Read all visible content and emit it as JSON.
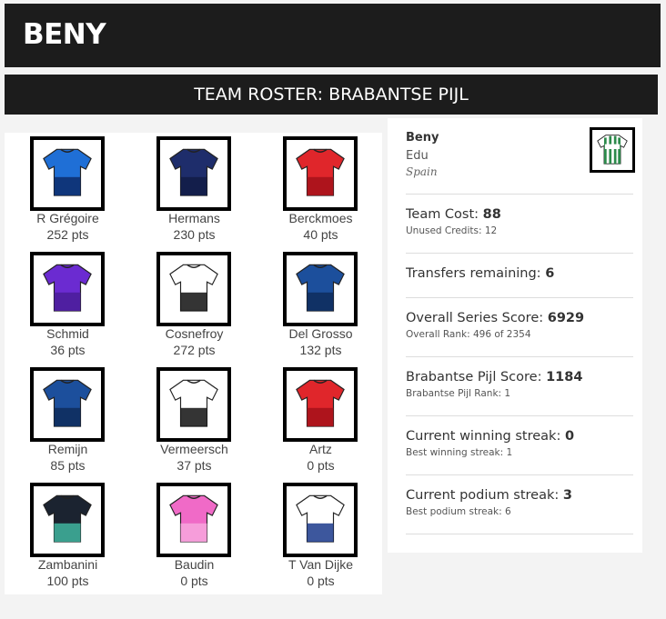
{
  "header": {
    "brand": "BENY"
  },
  "roster_title": "TEAM ROSTER: BRABANTSE PIJL",
  "riders": [
    {
      "name": "R Grégoire",
      "points": "252 pts",
      "jersey_icon": "groupama-fdj-jersey-icon",
      "colors": [
        "#1f6fd6",
        "#0d2d6b"
      ]
    },
    {
      "name": "Hermans",
      "points": "230 pts",
      "jersey_icon": "israel-premier-tech-jersey-icon",
      "colors": [
        "#1e2d6b",
        "#121c45"
      ]
    },
    {
      "name": "Berckmoes",
      "points": "40 pts",
      "jersey_icon": "lotto-jersey-icon",
      "colors": [
        "#e0262b",
        "#a5121a"
      ]
    },
    {
      "name": "Schmid",
      "points": "36 pts",
      "jersey_icon": "jayco-alula-jersey-icon",
      "colors": [
        "#6b2bd1",
        "#4a1d99"
      ]
    },
    {
      "name": "Cosnefroy",
      "points": "272 pts",
      "jersey_icon": "uae-team-emirates-jersey-icon",
      "colors": [
        "#ffffff",
        "#111111"
      ]
    },
    {
      "name": "Del Grosso",
      "points": "132 pts",
      "jersey_icon": "alpecin-jersey-icon",
      "colors": [
        "#1c4f9c",
        "#0e2b5c"
      ]
    },
    {
      "name": "Remijn",
      "points": "85 pts",
      "jersey_icon": "alpecin-jersey-icon",
      "colors": [
        "#1c4f9c",
        "#0e2b5c"
      ]
    },
    {
      "name": "Vermeersch",
      "points": "37 pts",
      "jersey_icon": "uae-team-emirates-jersey-icon",
      "colors": [
        "#ffffff",
        "#111111"
      ]
    },
    {
      "name": "Artz",
      "points": "0 pts",
      "jersey_icon": "lotto-jersey-icon",
      "colors": [
        "#e0262b",
        "#a5121a"
      ]
    },
    {
      "name": "Zambanini",
      "points": "100 pts",
      "jersey_icon": "bahrain-victorious-jersey-icon",
      "colors": [
        "#1b2330",
        "#3fb59f"
      ]
    },
    {
      "name": "Baudin",
      "points": "0 pts",
      "jersey_icon": "ef-education-jersey-icon",
      "colors": [
        "#f06ac7",
        "#f7a6dd"
      ]
    },
    {
      "name": "T Van Dijke",
      "points": "0 pts",
      "jersey_icon": "red-bull-bora-jersey-icon",
      "colors": [
        "#ffffff",
        "#1b3a8c"
      ]
    }
  ],
  "profile": {
    "username": "Beny",
    "team_name": "Edu",
    "country": "Spain",
    "jersey_icon": "green-white-striped-jersey-icon"
  },
  "stats": {
    "team_cost_label": "Team Cost:",
    "team_cost_value": "88",
    "unused_credits": "Unused Credits: 12",
    "transfers_label": "Transfers remaining:",
    "transfers_value": "6",
    "series_label": "Overall Series Score:",
    "series_value": "6929",
    "series_rank": "Overall Rank: 496 of 2354",
    "race_label": "Brabantse Pijl Score:",
    "race_value": "1184",
    "race_rank": "Brabantse Pijl Rank: 1",
    "win_label": "Current winning streak:",
    "win_value": "0",
    "win_best": "Best winning streak: 1",
    "podium_label": "Current podium streak:",
    "podium_value": "3",
    "podium_best": "Best podium streak: 6"
  }
}
